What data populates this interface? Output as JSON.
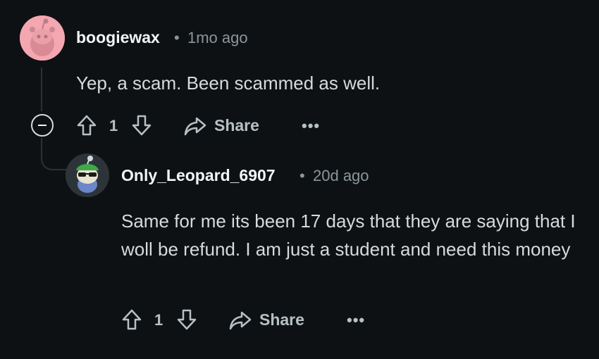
{
  "comments": [
    {
      "username": "boogiewax",
      "separator": "•",
      "time": "1mo ago",
      "body": "Yep, a scam. Been scammed as well.",
      "votes": "1",
      "share_label": "Share",
      "more_label": "•••",
      "avatar_color": "#f4a7b0"
    },
    {
      "username": "Only_Leopard_6907",
      "separator": "•",
      "time": "20d ago",
      "body": "Same for me its been 17 days that they are saying that I woll be refund. I am just a student and need this money",
      "votes": "1",
      "share_label": "Share",
      "more_label": "•••",
      "avatar_color": "#2c3439"
    }
  ],
  "colors": {
    "background": "#0e1113",
    "text": "#d7dadc",
    "muted": "#8b969c",
    "action": "#b7c0c4"
  }
}
